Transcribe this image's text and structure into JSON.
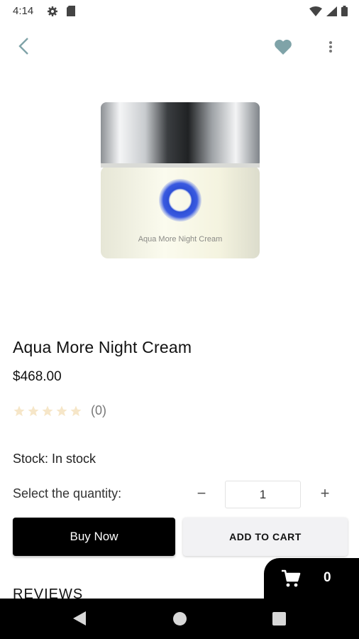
{
  "status_bar": {
    "time": "4:14",
    "icons": [
      "gear-icon",
      "sd-card-icon",
      "wifi-icon",
      "signal-icon",
      "battery-icon"
    ]
  },
  "app_bar": {
    "back_icon": "chevron-left-icon",
    "favorite_icon": "heart-icon",
    "more_icon": "more-vert-icon",
    "accent_color": "#7fa3a8"
  },
  "product": {
    "image_label": "Aqua More Night Cream",
    "title": "Aqua More Night Cream",
    "price": "$468.00",
    "rating_stars": 0,
    "rating_max": 5,
    "rating_count": "(0)",
    "stock": "Stock: In stock"
  },
  "quantity": {
    "label": "Select the quantity:",
    "minus": "−",
    "value": "1",
    "plus": "+"
  },
  "actions": {
    "buy_now": "Buy Now",
    "add_to_cart": "ADD TO CART"
  },
  "reviews": {
    "heading": "REVIEWS"
  },
  "cart": {
    "icon": "cart-icon",
    "count": "0"
  },
  "colors": {
    "star_empty": "#f6e6c8",
    "primary_button": "#000000",
    "secondary_button": "#f2f2f4"
  }
}
